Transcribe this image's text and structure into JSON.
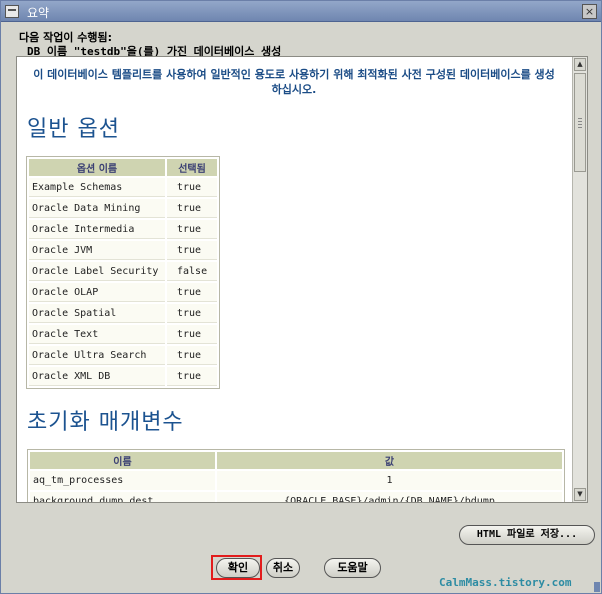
{
  "window": {
    "title": "요약",
    "close_glyph": "×"
  },
  "header": {
    "line1": "다음 작업이 수행됨:",
    "line2": "DB 이름 \"testdb\"을(를) 가진 데이터베이스 생성"
  },
  "content": {
    "intro": "이 데이터베이스 템플리트를 사용하여 일반적인 용도로 사용하기 위해 최적화된 사전 구성된 데이터베이스를 생성하십시오.",
    "section_general": "일반 옵션",
    "options_table": {
      "headers": [
        "옵션 이름",
        "선택됨"
      ],
      "rows": [
        [
          "Example Schemas",
          "true"
        ],
        [
          "Oracle Data Mining",
          "true"
        ],
        [
          "Oracle Intermedia",
          "true"
        ],
        [
          "Oracle JVM",
          "true"
        ],
        [
          "Oracle Label Security",
          "false"
        ],
        [
          "Oracle OLAP",
          "true"
        ],
        [
          "Oracle Spatial",
          "true"
        ],
        [
          "Oracle Text",
          "true"
        ],
        [
          "Oracle Ultra Search",
          "true"
        ],
        [
          "Oracle XML DB",
          "true"
        ]
      ]
    },
    "section_init": "초기화 매개변수",
    "params_table": {
      "headers": [
        "이름",
        "값"
      ],
      "rows": [
        [
          "aq_tm_processes",
          "1"
        ],
        [
          "background_dump_dest",
          "{ORACLE_BASE}/admin/{DB_NAME}/bdump"
        ]
      ]
    }
  },
  "scrollbar": {
    "up": "▲",
    "down": "▼"
  },
  "buttons": {
    "save_html": "HTML 파일로 저장...",
    "ok": "확인",
    "cancel": "취소",
    "help": "도움말"
  },
  "watermark": "CalmMass.tistory.com",
  "colors": {
    "title_bar": "#7e93bb",
    "heading": "#1c5390",
    "highlight": "#e21c1c",
    "table_header": "#cfd4b1"
  }
}
